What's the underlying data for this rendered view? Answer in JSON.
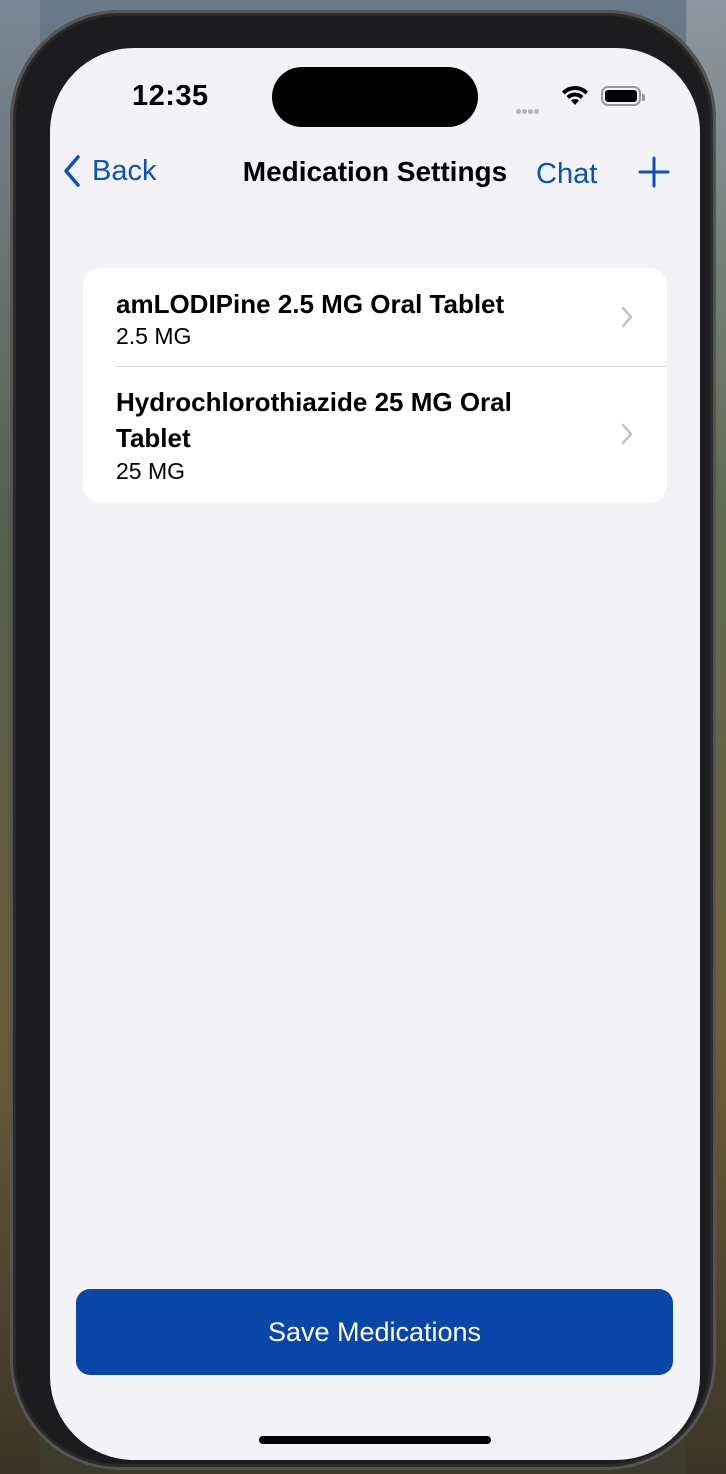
{
  "status": {
    "time": "12:35"
  },
  "nav": {
    "back_label": "Back",
    "title": "Medication Settings",
    "chat_label": "Chat",
    "add_icon": "plus-icon"
  },
  "medications": [
    {
      "name": "amLODIPine 2.5 MG Oral Tablet",
      "dose": "2.5 MG"
    },
    {
      "name": "Hydrochlorothiazide 25 MG Oral Tablet",
      "dose": "25 MG"
    }
  ],
  "save_button": {
    "label": "Save Medications"
  },
  "colors": {
    "accent": "#0a52b8",
    "button": "#0a45a8",
    "background": "#f2f2f7"
  }
}
